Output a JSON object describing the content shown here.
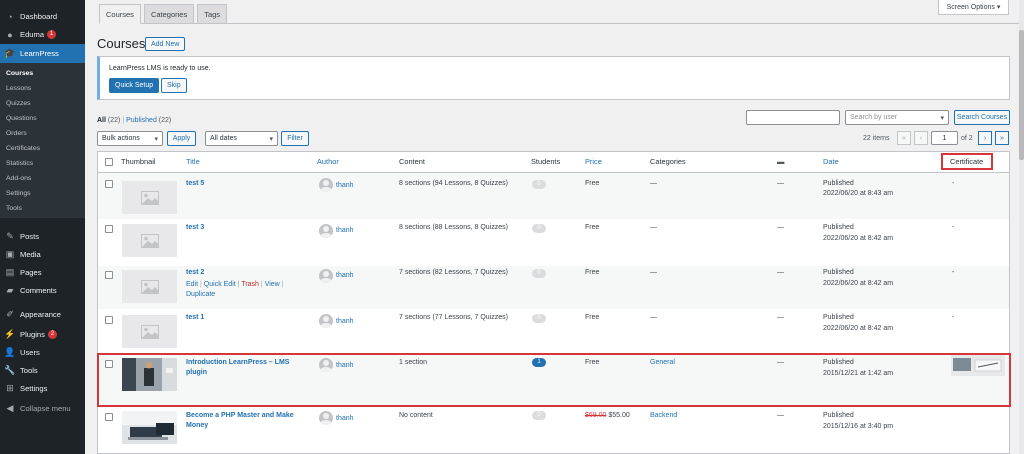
{
  "sidebar": {
    "top_items": [
      {
        "label": "Dashboard",
        "icon": "dashboard-icon"
      },
      {
        "label": "Eduma",
        "icon": "eduma-icon",
        "badge": "1"
      },
      {
        "label": "LearnPress",
        "icon": "learnpress-icon"
      }
    ],
    "submenu": [
      "Courses",
      "Lessons",
      "Quizzes",
      "Questions",
      "Orders",
      "Certificates",
      "Statistics",
      "Add-ons",
      "Settings",
      "Tools"
    ],
    "bottom_items": [
      {
        "label": "Posts",
        "icon": "pin-icon"
      },
      {
        "label": "Media",
        "icon": "media-icon"
      },
      {
        "label": "Pages",
        "icon": "pages-icon"
      },
      {
        "label": "Comments",
        "icon": "comments-icon"
      },
      {
        "label": "Appearance",
        "icon": "brush-icon"
      },
      {
        "label": "Plugins",
        "icon": "plugins-icon",
        "badge": "2"
      },
      {
        "label": "Users",
        "icon": "users-icon"
      },
      {
        "label": "Tools",
        "icon": "wrench-icon"
      },
      {
        "label": "Settings",
        "icon": "settings-icon"
      },
      {
        "label": "Collapse menu",
        "icon": "collapse-icon"
      }
    ]
  },
  "tabs": [
    "Courses",
    "Categories",
    "Tags"
  ],
  "screen_options": "Screen Options ▾",
  "page": {
    "title": "Courses",
    "add_new": "Add New"
  },
  "notice": {
    "text": "LearnPress LMS is ready to use.",
    "quick_setup": "Quick Setup",
    "skip": "Skip"
  },
  "filters": {
    "all": "All",
    "all_count": "(22)",
    "sep": "|",
    "published": "Published",
    "published_count": "(22)",
    "bulk_actions": "Bulk actions",
    "apply": "Apply",
    "all_dates": "All dates",
    "filter": "Filter",
    "search_value": "",
    "search_by_user": "Search by user",
    "search_courses": "Search Courses"
  },
  "pagination": {
    "items": "22 items",
    "first": "«",
    "prev": "‹",
    "current": "1",
    "of": "of 2",
    "next": "›",
    "last": "»"
  },
  "columns": [
    "Thumbnail",
    "Title",
    "Author",
    "Content",
    "Students",
    "Price",
    "Categories",
    "Date",
    "Certificate"
  ],
  "rows": [
    {
      "title": "test 5",
      "author": "thanh",
      "content": "8 sections (94 Lessons, 8 Quizzes)",
      "students": "0",
      "price": "Free",
      "categories": "—",
      "comments": "—",
      "status": "Published",
      "date": "2022/06/20 at 8:43 am",
      "certificate": "-"
    },
    {
      "title": "test 3",
      "author": "thanh",
      "content": "8 sections (88 Lessons, 8 Quizzes)",
      "students": "0",
      "price": "Free",
      "categories": "—",
      "comments": "—",
      "status": "Published",
      "date": "2022/06/20 at 8:42 am",
      "certificate": "-"
    },
    {
      "title": "test 2",
      "author": "thanh",
      "content": "7 sections (82 Lessons, 7 Quizzes)",
      "students": "0",
      "price": "Free",
      "categories": "—",
      "comments": "—",
      "status": "Published",
      "date": "2022/06/20 at 8:42 am",
      "certificate": "-",
      "actions": {
        "edit": "Edit",
        "sep1": "|",
        "quick_edit": "Quick Edit",
        "sep2": "|",
        "trash": "Trash",
        "sep3": "|",
        "view": "View",
        "sep4": "|",
        "duplicate": "Duplicate"
      }
    },
    {
      "title": "test 1",
      "author": "thanh",
      "content": "7 sections (77 Lessons, 7 Quizzes)",
      "students": "0",
      "price": "Free",
      "categories": "—",
      "comments": "—",
      "status": "Published",
      "date": "2022/06/20 at 8:42 am",
      "certificate": "-"
    },
    {
      "title_line1": "Introduction LearnPress – LMS",
      "title_line2": "plugin",
      "author": "thanh",
      "content": "1 section",
      "students": "1",
      "price": "Free",
      "categories": "General",
      "comments": "—",
      "status": "Published",
      "date": "2015/12/21 at 1:42 am"
    },
    {
      "title_line1": "Become a PHP Master and Make",
      "title_line2": "Money",
      "author": "thanh",
      "content": "No content",
      "students": "0",
      "price_old": "$69.00",
      "price": "$55.00",
      "categories": "Backend",
      "comments": "—",
      "status": "Published",
      "date": "2015/12/16 at 3:40 pm"
    }
  ],
  "colors": {
    "sidebar_bg": "#1d2327",
    "accent": "#2271b1",
    "highlight": "#d63638"
  }
}
